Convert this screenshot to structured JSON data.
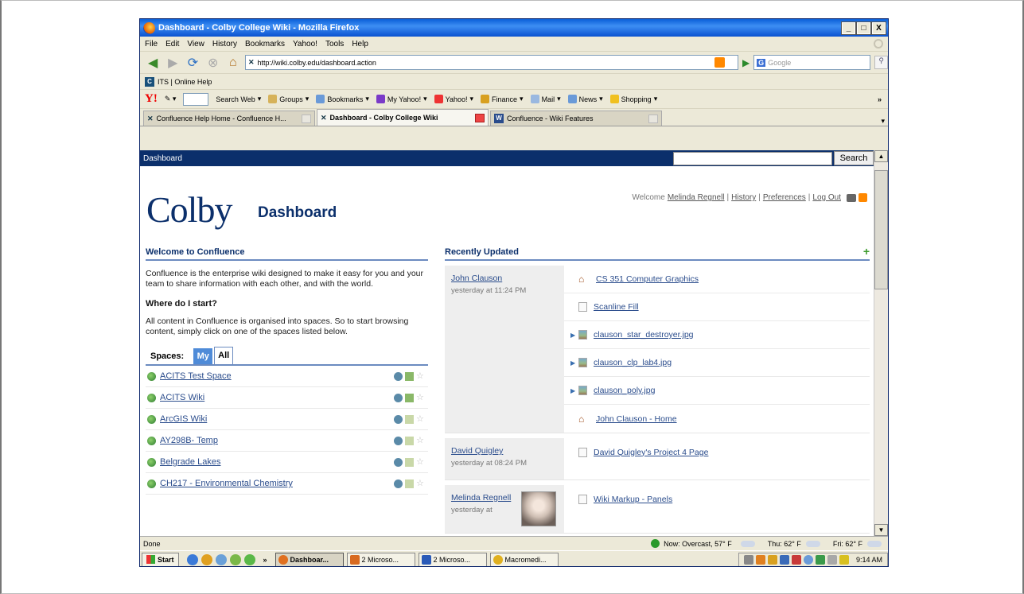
{
  "window": {
    "title": "Dashboard - Colby College Wiki - Mozilla Firefox",
    "min": "_",
    "max": "□",
    "close": "X"
  },
  "menu": [
    "File",
    "Edit",
    "View",
    "History",
    "Bookmarks",
    "Yahoo!",
    "Tools",
    "Help"
  ],
  "nav": {
    "url": "http://wiki.colby.edu/dashboard.action",
    "search_placeholder": "Google"
  },
  "bookmarks": [
    {
      "label": "ITS | Online Help"
    }
  ],
  "yahoo_toolbar": {
    "logo": "Y!",
    "items": [
      "Search Web",
      "Groups",
      "Bookmarks",
      "My Yahoo!",
      "Yahoo!",
      "Finance",
      "Mail",
      "News",
      "Shopping"
    ],
    "overflow": "»"
  },
  "tabs": [
    {
      "label": "Confluence Help Home - Confluence H..."
    },
    {
      "label": "Dashboard - Colby College Wiki"
    },
    {
      "label": "Confluence - Wiki Features"
    }
  ],
  "page": {
    "breadcrumb": "Dashboard",
    "search_button": "Search",
    "logo": "Colby",
    "title": "Dashboard",
    "welcome_prefix": "Welcome",
    "user_link": "Melinda Regnell",
    "history_link": "History",
    "preferences_link": "Preferences",
    "logout_link": "Log Out",
    "sep": "|"
  },
  "welcome_section": {
    "title": "Welcome to Confluence",
    "intro": "Confluence is the enterprise wiki designed to make it easy for you and your team to share information with each other, and with the world.",
    "start_heading": "Where do I start?",
    "start_text": "All content in Confluence is organised into spaces. So to start browsing content, simply click on one of the spaces listed below."
  },
  "spaces": {
    "label": "Spaces:",
    "tab_my": "My",
    "tab_all": "All",
    "items": [
      {
        "name": "ACITS Test Space"
      },
      {
        "name": "ACITS Wiki"
      },
      {
        "name": "ArcGIS Wiki"
      },
      {
        "name": "AY298B- Temp"
      },
      {
        "name": "Belgrade Lakes"
      },
      {
        "name": "CH217 - Environmental Chemistry"
      }
    ]
  },
  "recently_updated": {
    "title": "Recently Updated",
    "plus": "+",
    "groups": [
      {
        "user": "John Clauson",
        "time": "yesterday at 11:24 PM",
        "items": [
          {
            "title": "CS 351 Computer Graphics"
          },
          {
            "title": "Scanline Fill"
          },
          {
            "title": "clauson_star_destroyer.jpg"
          },
          {
            "title": "clauson_clp_lab4.jpg"
          },
          {
            "title": "clauson_poly.jpg"
          },
          {
            "title": "John Clauson - Home"
          }
        ]
      },
      {
        "user": "David Quigley",
        "time": "yesterday at 08:24 PM",
        "items": [
          {
            "title": "David Quigley's Project 4 Page"
          }
        ]
      },
      {
        "user": "Melinda Regnell",
        "time": "yesterday at",
        "items": [
          {
            "title": "Wiki Markup - Panels"
          }
        ]
      }
    ]
  },
  "status": {
    "text": "Done",
    "weather_now": "Now: Overcast, 57° F",
    "weather_thu": "Thu: 62° F",
    "weather_fri": "Fri: 62° F"
  },
  "taskbar": {
    "start": "Start",
    "chevron": "»",
    "tasks": [
      {
        "label": "Dashboar..."
      },
      {
        "label": "2 Microso..."
      },
      {
        "label": "2 Microso..."
      },
      {
        "label": "Macromedi..."
      }
    ],
    "clock": "9:14 AM"
  }
}
